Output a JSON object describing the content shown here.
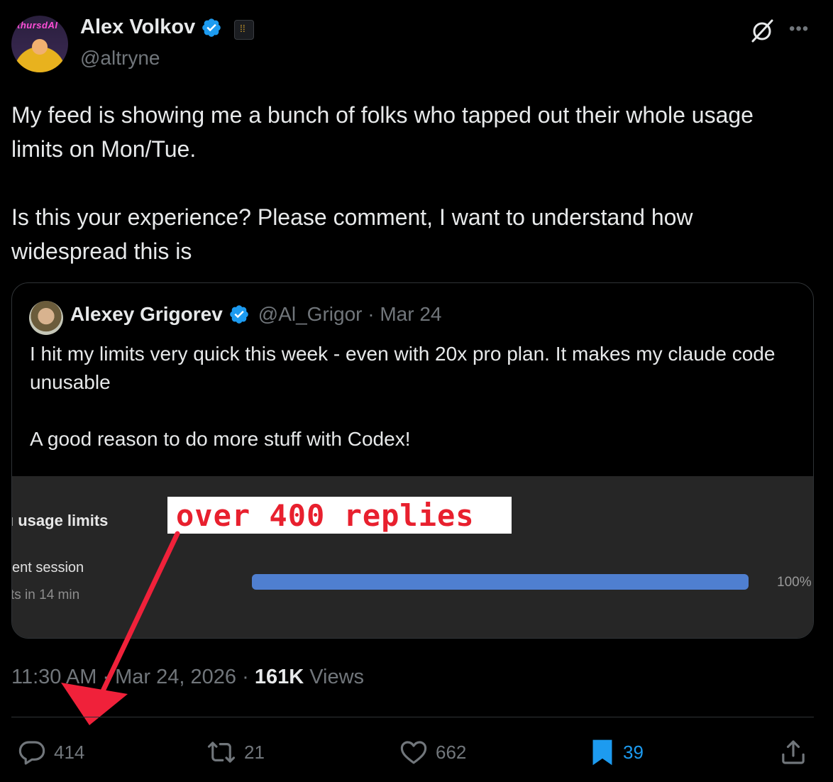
{
  "author": {
    "display_name": "Alex Volkov",
    "handle": "@altryne",
    "avatar_overlay_text": "thursdAI"
  },
  "tweet": {
    "text": "My feed is showing me a bunch of folks who tapped out their whole usage limits on Mon/Tue.\n\nIs this your experience? Please comment, I want to understand how widespread this is",
    "timestamp": "11:30 AM · Mar 24, 2026",
    "views_count": "161K",
    "views_label": "Views"
  },
  "quoted": {
    "display_name": "Alexey Grigorev",
    "handle": "@Al_Grigor",
    "date": "Mar 24",
    "text": "I hit my limits very quick this week - even with 20x pro plan. It makes my claude code unusable\n\nA good reason to do more stuff with Codex!",
    "image": {
      "title": "usage limits",
      "session_label": "ent session",
      "reset_label": "ts in 14 min",
      "progress_percent": 100,
      "progress_text": "100%"
    }
  },
  "annotation": {
    "text": "over 400 replies",
    "color": "#e8202e"
  },
  "actions": {
    "replies": "414",
    "reposts": "21",
    "likes": "662",
    "bookmarks": "39"
  },
  "colors": {
    "background": "#000000",
    "text": "#e7e9ea",
    "muted": "#71767b",
    "accent": "#1d9bf0",
    "progress_fill": "#4f7fd0"
  },
  "icons": [
    "verified-icon",
    "affiliate-badge-icon",
    "grok-icon",
    "more-icon",
    "reply-icon",
    "repost-icon",
    "like-icon",
    "bookmark-icon",
    "share-icon"
  ]
}
